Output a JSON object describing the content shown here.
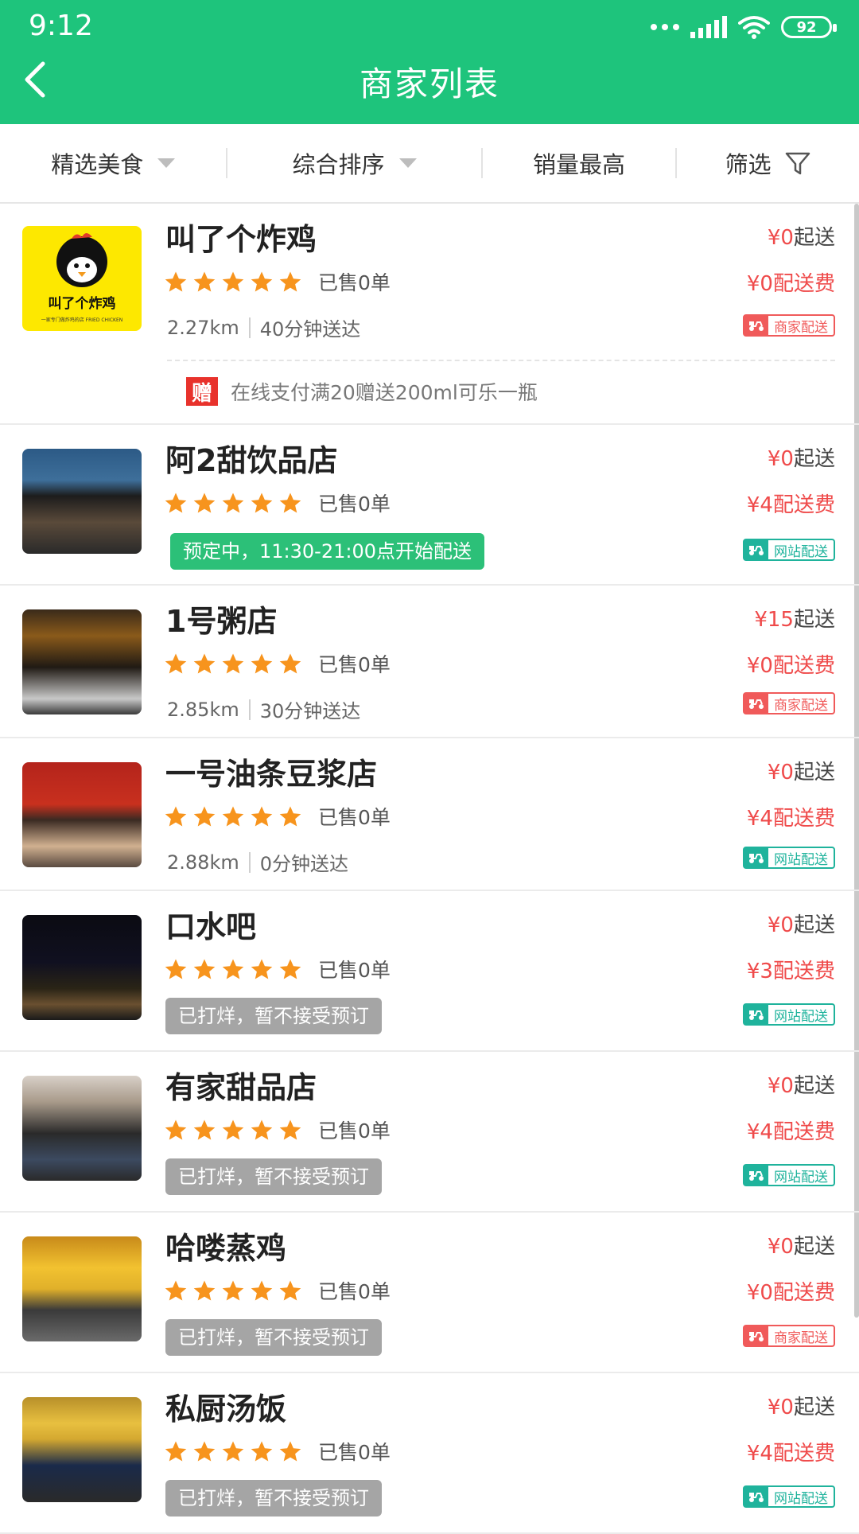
{
  "status_bar": {
    "time": "9:12",
    "battery": "92"
  },
  "header": {
    "title": "商家列表"
  },
  "filters": [
    {
      "label": "精选美食"
    },
    {
      "label": "综合排序"
    },
    {
      "label": "销量最高"
    },
    {
      "label": "筛选"
    }
  ],
  "colors": {
    "brand_green": "#1ec47c",
    "price_red": "#ef4a4a",
    "merchant_badge": "#f05a5a",
    "site_badge": "#1fb39c"
  },
  "stores": [
    {
      "name": "叫了个炸鸡",
      "rating": 5,
      "sold": "已售0单",
      "distance": "2.27km",
      "eta": "40分钟送达",
      "min_prefix": "¥0",
      "min_suffix": "起送",
      "fee_prefix": "¥0",
      "fee_suffix": "配送费",
      "delivery_badge": "商家配送",
      "badge_type": "merchant",
      "promo_icon": "赠",
      "promo_text": "在线支付满20赠送200ml可乐一瓶",
      "logo_text": "叫了个炸鸡",
      "logo_tagline": "一家专门做炸鸡的店 FRIED CHICKEN"
    },
    {
      "name": "阿2甜饮品店",
      "rating": 5,
      "sold": "已售0单",
      "status": "预定中，11:30-21:00点开始配送",
      "status_type": "green",
      "min_prefix": "¥0",
      "min_suffix": "起送",
      "fee_prefix": "¥4",
      "fee_suffix": "配送费",
      "delivery_badge": "网站配送",
      "badge_type": "site"
    },
    {
      "name": "1号粥店",
      "rating": 5,
      "sold": "已售0单",
      "distance": "2.85km",
      "eta": "30分钟送达",
      "min_prefix": "¥15",
      "min_suffix": "起送",
      "fee_prefix": "¥0",
      "fee_suffix": "配送费",
      "delivery_badge": "商家配送",
      "badge_type": "merchant"
    },
    {
      "name": "一号油条豆浆店",
      "rating": 5,
      "sold": "已售0单",
      "distance": "2.88km",
      "eta": "0分钟送达",
      "min_prefix": "¥0",
      "min_suffix": "起送",
      "fee_prefix": "¥4",
      "fee_suffix": "配送费",
      "delivery_badge": "网站配送",
      "badge_type": "site"
    },
    {
      "name": "口水吧",
      "rating": 5,
      "sold": "已售0单",
      "status": "已打烊，暂不接受预订",
      "status_type": "gray",
      "min_prefix": "¥0",
      "min_suffix": "起送",
      "fee_prefix": "¥3",
      "fee_suffix": "配送费",
      "delivery_badge": "网站配送",
      "badge_type": "site"
    },
    {
      "name": "有家甜品店",
      "rating": 5,
      "sold": "已售0单",
      "status": "已打烊，暂不接受预订",
      "status_type": "gray",
      "min_prefix": "¥0",
      "min_suffix": "起送",
      "fee_prefix": "¥4",
      "fee_suffix": "配送费",
      "delivery_badge": "网站配送",
      "badge_type": "site"
    },
    {
      "name": "哈喽蒸鸡",
      "rating": 5,
      "sold": "已售0单",
      "status": "已打烊，暂不接受预订",
      "status_type": "gray",
      "min_prefix": "¥0",
      "min_suffix": "起送",
      "fee_prefix": "¥0",
      "fee_suffix": "配送费",
      "delivery_badge": "商家配送",
      "badge_type": "merchant"
    },
    {
      "name": "私厨汤饭",
      "rating": 5,
      "sold": "已售0单",
      "status": "已打烊，暂不接受预订",
      "status_type": "gray",
      "min_prefix": "¥0",
      "min_suffix": "起送",
      "fee_prefix": "¥4",
      "fee_suffix": "配送费",
      "delivery_badge": "网站配送",
      "badge_type": "site"
    }
  ]
}
